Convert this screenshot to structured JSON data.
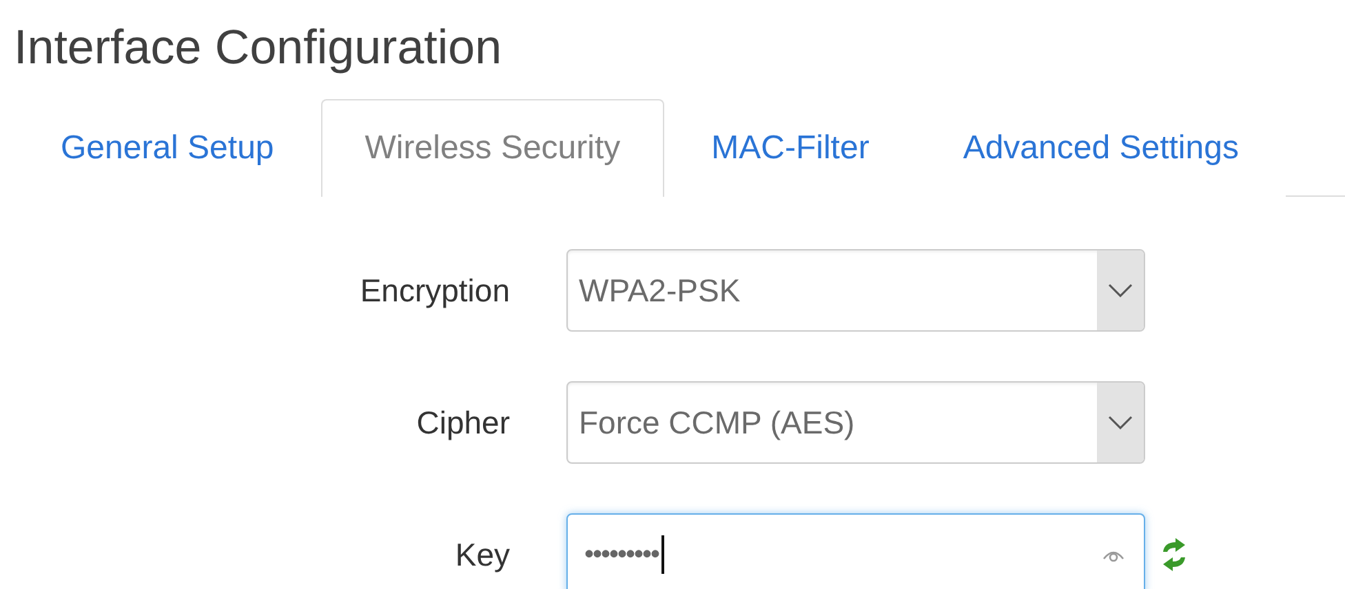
{
  "title": "Interface Configuration",
  "tabs": [
    {
      "label": "General Setup",
      "selected": false
    },
    {
      "label": "Wireless Security",
      "selected": true
    },
    {
      "label": "MAC-Filter",
      "selected": false
    },
    {
      "label": "Advanced Settings",
      "selected": false
    }
  ],
  "fields": [
    {
      "kind": "select",
      "label": "Encryption",
      "value": "WPA2-PSK",
      "focused": false
    },
    {
      "kind": "select",
      "label": "Cipher",
      "value": "Force CCMP (AES)",
      "focused": false
    },
    {
      "kind": "password",
      "label": "Key",
      "value": "•••••••••",
      "focused": true
    }
  ]
}
